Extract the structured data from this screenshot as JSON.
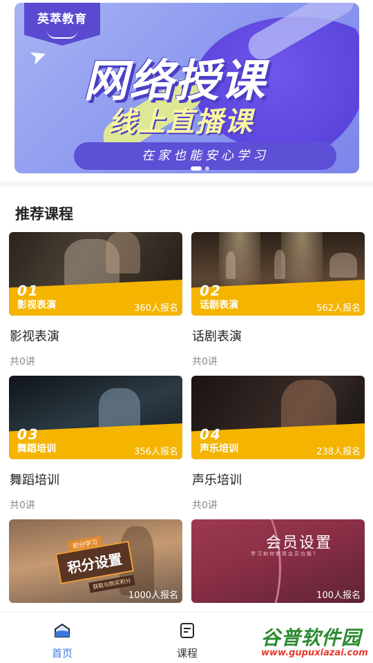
{
  "banner": {
    "brand": "英萃教育",
    "title": "网络授课",
    "subtitle": "线上直播课",
    "slogan": "在家也能安心学习",
    "slide_count": 2,
    "active_slide": 1
  },
  "section": {
    "title": "推荐课程"
  },
  "courses": [
    {
      "num": "01",
      "tag": "影视表演",
      "count": "360人报名",
      "name": "影视表演",
      "lessons": "共0讲"
    },
    {
      "num": "02",
      "tag": "话剧表演",
      "count": "562人报名",
      "name": "话剧表演",
      "lessons": "共0讲"
    },
    {
      "num": "03",
      "tag": "舞蹈培训",
      "count": "356人报名",
      "name": "舞蹈培训",
      "lessons": "共0讲"
    },
    {
      "num": "04",
      "tag": "声乐培训",
      "count": "238人报名",
      "name": "声乐培训",
      "lessons": "共0讲"
    },
    {
      "count": "1000人报名",
      "promo_small": "积分学习",
      "promo_title": "积分设置",
      "promo_sub": "获取与购买积分"
    },
    {
      "count": "100人报名",
      "promo_title": "会员设置",
      "promo_sub": "学习如何使用会员功能？"
    }
  ],
  "tabbar": {
    "items": [
      {
        "label": "首页",
        "icon": "home-icon",
        "active": true
      },
      {
        "label": "课程",
        "icon": "course-list-icon",
        "active": false
      }
    ]
  },
  "watermark": {
    "main": "谷普软件园",
    "url": "www.gupuxiazai.com"
  },
  "colors": {
    "accent": "#3a78e0",
    "ribbon": "#f4b400",
    "banner_purple": "#5d4fd6"
  }
}
